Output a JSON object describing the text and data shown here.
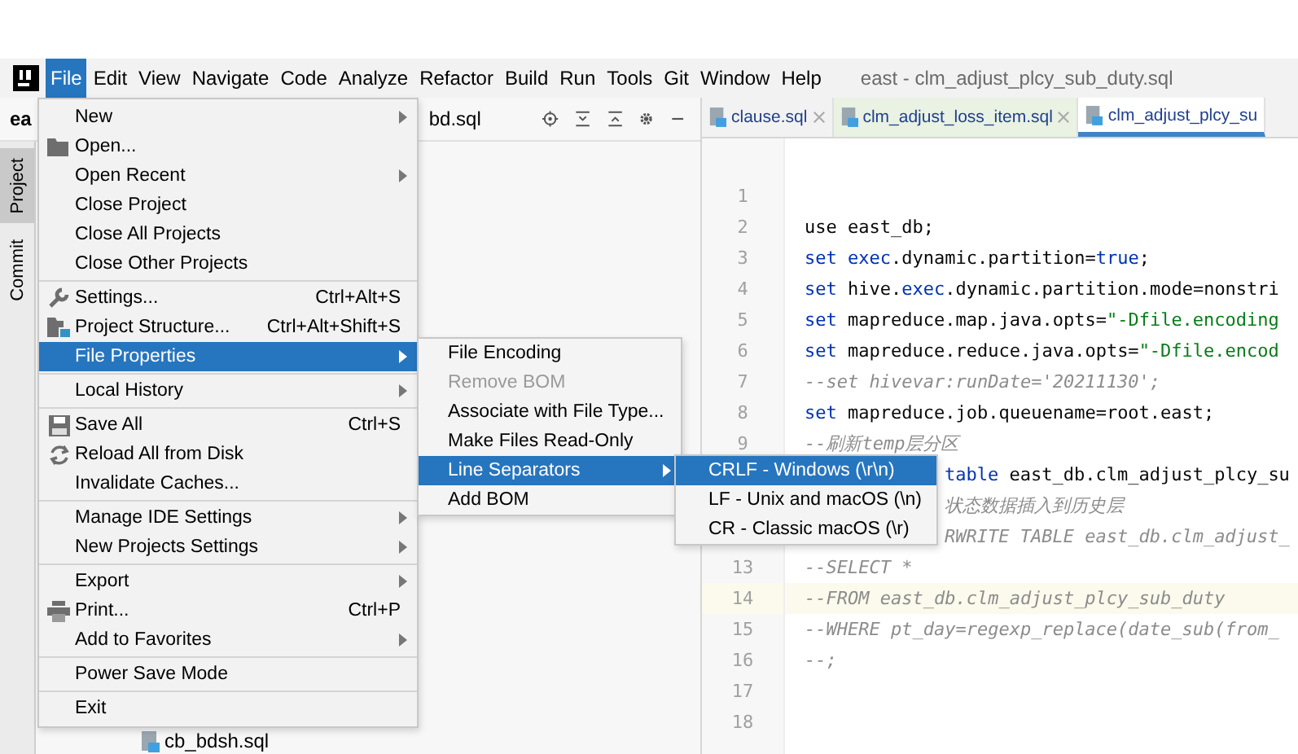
{
  "menu_bar": {
    "items": [
      {
        "label": "File",
        "selected": true
      },
      {
        "label": "Edit",
        "selected": false
      },
      {
        "label": "View",
        "selected": false
      },
      {
        "label": "Navigate",
        "selected": false
      },
      {
        "label": "Code",
        "selected": false
      },
      {
        "label": "Analyze",
        "selected": false
      },
      {
        "label": "Refactor",
        "selected": false
      },
      {
        "label": "Build",
        "selected": false
      },
      {
        "label": "Run",
        "selected": false
      },
      {
        "label": "Tools",
        "selected": false
      },
      {
        "label": "Git",
        "selected": false
      },
      {
        "label": "Window",
        "selected": false
      },
      {
        "label": "Help",
        "selected": false
      }
    ],
    "title": "east - clm_adjust_plcy_sub_duty.sql"
  },
  "toolbar": {
    "project_name": "ea",
    "file_name": "bd.sql"
  },
  "side_tabs": [
    {
      "label": "Project",
      "selected": true
    },
    {
      "label": "Commit",
      "selected": false
    }
  ],
  "project_tree": {
    "items": [
      {
        "label": "cb_bdsh.sql"
      }
    ]
  },
  "editor": {
    "tabs": [
      {
        "label": "clause.sql",
        "selected": false,
        "color": "#f2f2f2"
      },
      {
        "label": "clm_adjust_loss_item.sql",
        "selected": false,
        "color": "#e9f2e3"
      },
      {
        "label": "clm_adjust_plcy_su",
        "selected": true,
        "color": "#ffffff"
      }
    ],
    "lines": [
      {
        "number": "1",
        "current": false,
        "kind": "full"
      },
      {
        "number": "2",
        "current": false,
        "kind": "full",
        "tokens": [
          {
            "text": "use east_db;",
            "kind": "plain"
          }
        ]
      },
      {
        "number": "3",
        "current": false,
        "kind": "full",
        "tokens": [
          {
            "text": "set ",
            "kind": "keyword"
          },
          {
            "text": "exec",
            "kind": "keyword"
          },
          {
            "text": ".dynamic.partition=",
            "kind": "plain"
          },
          {
            "text": "true",
            "kind": "keyword"
          },
          {
            "text": ";",
            "kind": "plain"
          }
        ]
      },
      {
        "number": "4",
        "current": false,
        "kind": "full",
        "tokens": [
          {
            "text": "set ",
            "kind": "keyword"
          },
          {
            "text": "hive.",
            "kind": "plain"
          },
          {
            "text": "exec",
            "kind": "keyword"
          },
          {
            "text": ".dynamic.partition.mode=nonstri",
            "kind": "plain"
          }
        ]
      },
      {
        "number": "5",
        "current": false,
        "kind": "full",
        "tokens": [
          {
            "text": "set ",
            "kind": "keyword"
          },
          {
            "text": "mapreduce.map.java.opts=",
            "kind": "plain"
          },
          {
            "text": "\"-Dfile.encoding",
            "kind": "string"
          }
        ]
      },
      {
        "number": "6",
        "current": false,
        "kind": "full",
        "tokens": [
          {
            "text": "set ",
            "kind": "keyword"
          },
          {
            "text": "mapreduce.reduce.java.opts=",
            "kind": "plain"
          },
          {
            "text": "\"-Dfile.encod",
            "kind": "string"
          }
        ]
      },
      {
        "number": "7",
        "current": false,
        "kind": "full",
        "tokens": [
          {
            "text": "--set hivevar:runDate='20211130';",
            "kind": "comment"
          }
        ]
      },
      {
        "number": "8",
        "current": false,
        "kind": "full",
        "tokens": [
          {
            "text": "set ",
            "kind": "keyword"
          },
          {
            "text": "mapreduce.job.queuename=root.east;",
            "kind": "plain"
          }
        ]
      },
      {
        "number": "9",
        "current": false,
        "kind": "full",
        "tokens": [
          {
            "text": "--刷新temp层分区",
            "kind": "comment"
          }
        ]
      },
      {
        "kind": "partial",
        "current": false,
        "tokens": [
          {
            "text": "table",
            "kind": "keyword"
          },
          {
            "text": " east_db.clm_adjust_plcy_su",
            "kind": "plain"
          }
        ]
      },
      {
        "kind": "partial",
        "current": false,
        "tokens": [
          {
            "text": "状态数据插入到历史层",
            "kind": "comment"
          }
        ]
      },
      {
        "kind": "partial",
        "current": false,
        "tokens": [
          {
            "text": "RWRITE TABLE east_db.clm_adjust_",
            "kind": "comment"
          }
        ]
      },
      {
        "number": "13",
        "current": false,
        "kind": "full",
        "tokens": [
          {
            "text": "--SELECT *",
            "kind": "comment"
          }
        ]
      },
      {
        "number": "14",
        "current": true,
        "kind": "full",
        "tokens": [
          {
            "text": "--FROM east_db.clm_adjust_plcy_sub_duty",
            "kind": "comment"
          }
        ]
      },
      {
        "number": "15",
        "current": false,
        "kind": "full",
        "tokens": [
          {
            "text": "--WHERE pt_day=regexp_replace(date_sub(from_",
            "kind": "comment"
          }
        ]
      },
      {
        "number": "16",
        "current": false,
        "kind": "full",
        "tokens": [
          {
            "text": "--;",
            "kind": "comment"
          }
        ]
      },
      {
        "number": "17",
        "current": false,
        "kind": "full"
      },
      {
        "number": "18",
        "current": false,
        "kind": "full"
      }
    ]
  },
  "file_menu": {
    "items": [
      {
        "kind": "item",
        "label": "New",
        "submenu": true,
        "selected": false
      },
      {
        "kind": "item",
        "label": "Open...",
        "selected": false
      },
      {
        "kind": "item",
        "label": "Open Recent",
        "submenu": true,
        "selected": false
      },
      {
        "kind": "item",
        "label": "Close Project",
        "selected": false
      },
      {
        "kind": "item",
        "label": "Close All Projects",
        "selected": false
      },
      {
        "kind": "item",
        "label": "Close Other Projects",
        "selected": false
      },
      {
        "kind": "separator"
      },
      {
        "kind": "item",
        "label": "Settings...",
        "shortcut": "Ctrl+Alt+S",
        "selected": false
      },
      {
        "kind": "item",
        "label": "Project Structure...",
        "shortcut": "Ctrl+Alt+Shift+S",
        "selected": false
      },
      {
        "kind": "item",
        "label": "File Properties",
        "submenu": true,
        "selected": true
      },
      {
        "kind": "separator"
      },
      {
        "kind": "item",
        "label": "Local History",
        "submenu": true,
        "selected": false
      },
      {
        "kind": "separator"
      },
      {
        "kind": "item",
        "label": "Save All",
        "shortcut": "Ctrl+S",
        "selected": false
      },
      {
        "kind": "item",
        "label": "Reload All from Disk",
        "selected": false
      },
      {
        "kind": "item",
        "label": "Invalidate Caches...",
        "selected": false
      },
      {
        "kind": "separator"
      },
      {
        "kind": "item",
        "label": "Manage IDE Settings",
        "submenu": true,
        "selected": false
      },
      {
        "kind": "item",
        "label": "New Projects Settings",
        "submenu": true,
        "selected": false
      },
      {
        "kind": "separator"
      },
      {
        "kind": "item",
        "label": "Export",
        "submenu": true,
        "selected": false
      },
      {
        "kind": "item",
        "label": "Print...",
        "shortcut": "Ctrl+P",
        "selected": false
      },
      {
        "kind": "item",
        "label": "Add to Favorites",
        "submenu": true,
        "selected": false
      },
      {
        "kind": "separator"
      },
      {
        "kind": "item",
        "label": "Power Save Mode",
        "selected": false
      },
      {
        "kind": "separator"
      },
      {
        "kind": "item",
        "label": "Exit",
        "selected": false
      }
    ]
  },
  "file_properties_menu": {
    "items": [
      {
        "label": "File Encoding",
        "selected": false,
        "disabled": false
      },
      {
        "label": "Remove BOM",
        "selected": false,
        "disabled": true
      },
      {
        "label": "Associate with File Type...",
        "selected": false,
        "disabled": false
      },
      {
        "label": "Make Files Read-Only",
        "selected": false,
        "disabled": false
      },
      {
        "label": "Line Separators",
        "submenu": true,
        "selected": true,
        "disabled": false
      },
      {
        "label": "Add BOM",
        "selected": false,
        "disabled": false
      }
    ]
  },
  "line_separators_menu": {
    "items": [
      {
        "label": "CRLF - Windows (\\r\\n)",
        "selected": true
      },
      {
        "label": "LF - Unix and macOS (\\n)",
        "selected": false
      },
      {
        "label": "CR - Classic macOS (\\r)",
        "selected": false
      }
    ]
  }
}
